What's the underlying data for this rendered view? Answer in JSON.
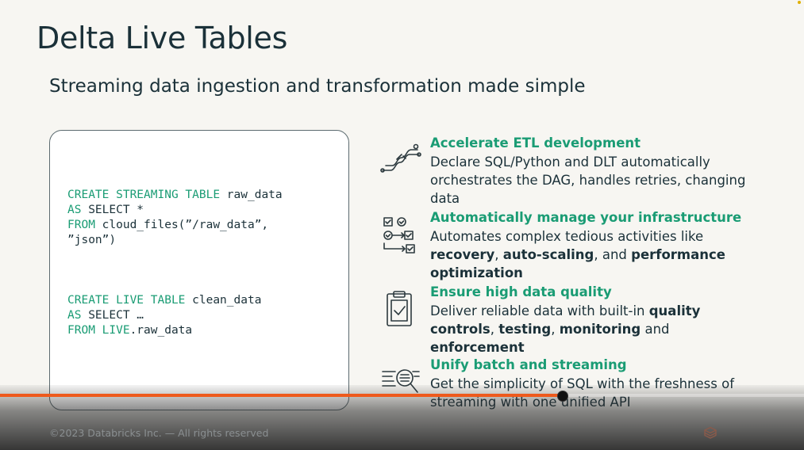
{
  "slide": {
    "title": "Delta Live Tables",
    "subtitle": "Streaming data ingestion and transformation made simple"
  },
  "code": {
    "block1": [
      {
        "kw": "CREATE STREAMING TABLE",
        "rest": " raw_data"
      },
      {
        "kw": "AS",
        "rest": " SELECT *"
      },
      {
        "kw": "FROM",
        "rest": " cloud_files(”/raw_data”,"
      },
      {
        "kw": "",
        "rest": "”json”)"
      }
    ],
    "block2": [
      {
        "kw": "CREATE LIVE TABLE",
        "rest": " clean_data"
      },
      {
        "kw": "AS",
        "rest": " SELECT …"
      },
      {
        "kw": "FROM LIVE",
        "rest": ".raw_data"
      }
    ]
  },
  "features": [
    {
      "icon": "pipeline-icon",
      "heading": "Accelerate ETL development",
      "desc": [
        {
          "t": "Declare SQL/Python and DLT automatically orchestrates the DAG, handles retries, changing data",
          "b": false
        }
      ]
    },
    {
      "icon": "workflow-checklist-icon",
      "heading": "Automatically manage your infrastructure",
      "desc": [
        {
          "t": "Automates complex tedious activities like ",
          "b": false
        },
        {
          "t": "recovery",
          "b": true
        },
        {
          "t": ", ",
          "b": false
        },
        {
          "t": "auto-scaling",
          "b": true
        },
        {
          "t": ", and ",
          "b": false
        },
        {
          "t": "performance optimization",
          "b": true
        }
      ]
    },
    {
      "icon": "clipboard-check-icon",
      "heading": "Ensure high data quality",
      "desc": [
        {
          "t": "Deliver reliable data with built-in ",
          "b": false
        },
        {
          "t": "quality controls",
          "b": true
        },
        {
          "t": ", ",
          "b": false
        },
        {
          "t": "testing",
          "b": true
        },
        {
          "t": ", ",
          "b": false
        },
        {
          "t": "monitoring",
          "b": true
        },
        {
          "t": " and ",
          "b": false
        },
        {
          "t": "enforcement",
          "b": true
        }
      ]
    },
    {
      "icon": "batch-stream-search-icon",
      "heading": "Unify batch and streaming",
      "desc": [
        {
          "t": "Get the simplicity of SQL with the freshness of streaming with one unified API",
          "b": false
        }
      ]
    }
  ],
  "footer": {
    "copyright": "©2023 Databricks Inc. — All rights reserved"
  },
  "player": {
    "progress_fraction": 0.7,
    "accent_color": "#ee5a1c"
  },
  "colors": {
    "accent_green": "#1a9c74",
    "text_dark": "#1b3139",
    "background": "#f7f6f2"
  }
}
